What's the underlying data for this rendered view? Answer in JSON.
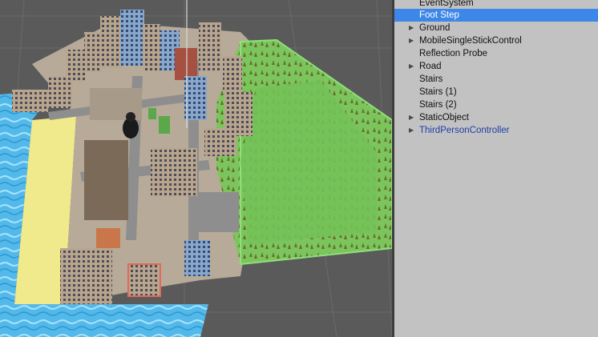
{
  "hierarchy": {
    "items": [
      {
        "label": "EventSystem",
        "expandable": false,
        "selected": false,
        "prefab": false
      },
      {
        "label": "Foot Step",
        "expandable": false,
        "selected": true,
        "prefab": false
      },
      {
        "label": "Ground",
        "expandable": true,
        "selected": false,
        "prefab": false
      },
      {
        "label": "MobileSingleStickControl",
        "expandable": true,
        "selected": false,
        "prefab": false
      },
      {
        "label": "Reflection Probe",
        "expandable": false,
        "selected": false,
        "prefab": false
      },
      {
        "label": "Road",
        "expandable": true,
        "selected": false,
        "prefab": false
      },
      {
        "label": "Stairs",
        "expandable": false,
        "selected": false,
        "prefab": false
      },
      {
        "label": "Stairs (1)",
        "expandable": false,
        "selected": false,
        "prefab": false
      },
      {
        "label": "Stairs (2)",
        "expandable": false,
        "selected": false,
        "prefab": false
      },
      {
        "label": "StaticObject",
        "expandable": true,
        "selected": false,
        "prefab": false
      },
      {
        "label": "ThirdPersonController",
        "expandable": true,
        "selected": false,
        "prefab": true
      }
    ]
  },
  "colors": {
    "selection": "#3d87e8",
    "prefab_text": "#1e3ea8",
    "panel_bg": "#c2c2c2",
    "scene_bg": "#5a5a5a",
    "water": "#4fb6e6",
    "sand": "#f0ea8c",
    "park_grass": "#79c25a"
  },
  "icons": {
    "expand": "triangle-right-icon"
  }
}
